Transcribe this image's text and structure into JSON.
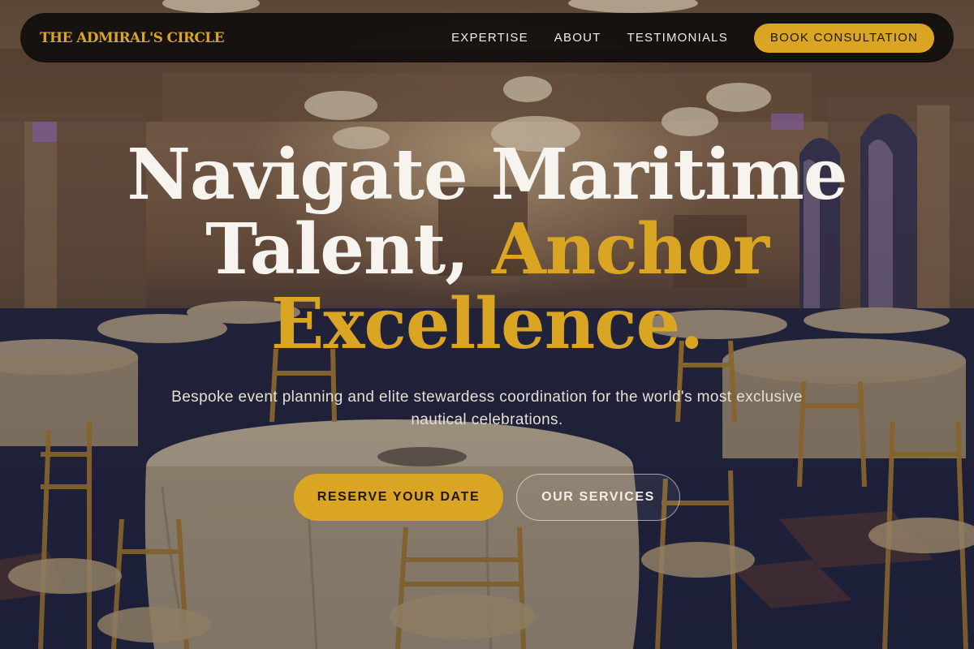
{
  "nav": {
    "brand": "THE ADMIRAL'S CIRCLE",
    "links": [
      "EXPERTISE",
      "ABOUT",
      "TESTIMONIALS"
    ],
    "cta_label": "BOOK CONSULTATION"
  },
  "hero": {
    "headline_line1": "Navigate Maritime",
    "headline_line2_white": "Talent, ",
    "headline_line2_gold": "Anchor",
    "headline_line3_gold": "Excellence.",
    "subline": "Bespoke event planning and elite stewardess coordination for the world's most exclusive nautical celebrations.",
    "primary_cta": "RESERVE YOUR DATE",
    "secondary_cta": "OUR SERVICES"
  },
  "background": {
    "description_icon": "ballroom-photo"
  },
  "colors": {
    "accent_gold": "#dba524",
    "nav_bg": "#0c0a0a",
    "headline_white": "#f7f3ee"
  }
}
